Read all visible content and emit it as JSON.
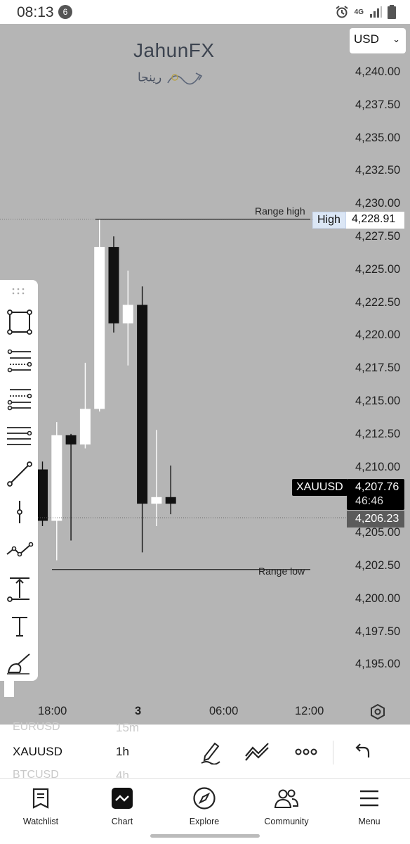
{
  "status_bar": {
    "time": "08:13",
    "notification_count": "6",
    "network": "4G"
  },
  "watermark": {
    "title": "JahunFX",
    "subtitle": "رینجا"
  },
  "currency": {
    "selected": "USD"
  },
  "price_axis": [
    "4,240.00",
    "4,237.50",
    "4,235.00",
    "4,232.50",
    "4,230.00",
    "4,227.50",
    "4,225.00",
    "4,222.50",
    "4,220.00",
    "4,217.50",
    "4,215.00",
    "4,212.50",
    "4,210.00",
    "4,205.00",
    "4,202.50",
    "4,200.00",
    "4,197.50",
    "4,195.00"
  ],
  "range_high": {
    "label": "Range high",
    "tag_label": "High",
    "tag_value": "4,228.91"
  },
  "range_low": {
    "label": "Range low"
  },
  "symbol_tag": "XAUUSD",
  "last_price": {
    "price": "4,207.76",
    "countdown": "46:46"
  },
  "mid_price": "4,206.23",
  "time_axis": [
    "18:00",
    "3",
    "06:00",
    "12:00"
  ],
  "chart_data": {
    "type": "candlestick",
    "symbol": "XAUUSD",
    "timeframe": "1h",
    "ylim": [
      4193.5,
      4241.5
    ],
    "candles": [
      {
        "open": 4209.9,
        "high": 4210.5,
        "low": 4205.6,
        "close": 4206.0
      },
      {
        "open": 4206.0,
        "high": 4213.5,
        "low": 4203.0,
        "close": 4212.5
      },
      {
        "open": 4212.5,
        "high": 4212.6,
        "low": 4204.5,
        "close": 4211.8
      },
      {
        "open": 4211.8,
        "high": 4218.0,
        "low": 4211.5,
        "close": 4214.5
      },
      {
        "open": 4214.5,
        "high": 4228.9,
        "low": 4214.3,
        "close": 4226.8
      },
      {
        "open": 4226.8,
        "high": 4227.6,
        "low": 4220.3,
        "close": 4221.0
      },
      {
        "open": 4221.0,
        "high": 4225.0,
        "low": 4217.8,
        "close": 4222.4
      },
      {
        "open": 4222.4,
        "high": 4223.8,
        "low": 4203.6,
        "close": 4207.3
      },
      {
        "open": 4207.3,
        "high": 4212.9,
        "low": 4205.6,
        "close": 4207.8
      },
      {
        "open": 4207.8,
        "high": 4210.2,
        "low": 4206.5,
        "close": 4207.3
      }
    ]
  },
  "drawing_tools": [
    "rectangle-tool-icon",
    "fib-retracement-icon",
    "fib-extension-icon",
    "parallel-lines-icon",
    "trend-line-icon",
    "vertical-line-icon",
    "path-icon",
    "measure-icon",
    "text-tool-icon",
    "brush-icon"
  ],
  "watchlist_strip": [
    {
      "symbol": "EURUSD",
      "timeframe": "15m"
    },
    {
      "symbol": "XAUUSD",
      "timeframe": "1h"
    },
    {
      "symbol": "BTCUSD",
      "timeframe": "4h"
    }
  ],
  "nav": [
    {
      "label": "Watchlist",
      "icon": "watchlist-icon"
    },
    {
      "label": "Chart",
      "icon": "chart-icon"
    },
    {
      "label": "Explore",
      "icon": "compass-icon"
    },
    {
      "label": "Community",
      "icon": "people-icon"
    },
    {
      "label": "Menu",
      "icon": "menu-icon"
    }
  ]
}
